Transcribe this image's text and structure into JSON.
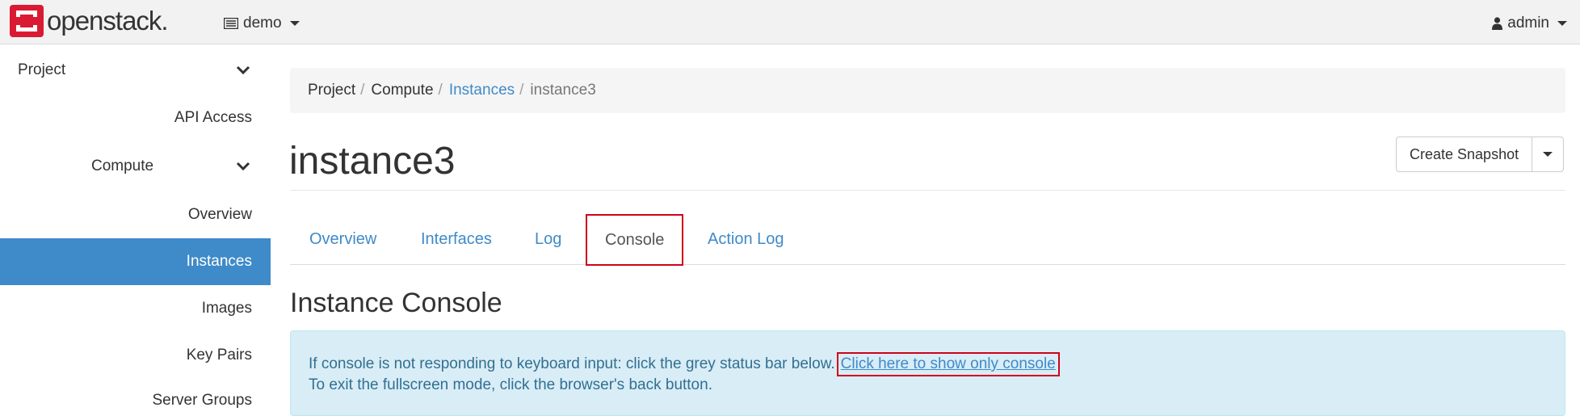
{
  "navbar": {
    "brand": "openstack.",
    "project_selector": "demo",
    "user_menu": "admin",
    "brand_color": "#da1a32"
  },
  "sidebar": {
    "items": [
      {
        "label": "Project",
        "has_chevron": true,
        "active": false
      },
      {
        "label": "API Access",
        "has_chevron": false,
        "active": false
      },
      {
        "label": "Compute",
        "has_chevron": true,
        "active": false
      },
      {
        "label": "Overview",
        "has_chevron": false,
        "active": false
      },
      {
        "label": "Instances",
        "has_chevron": false,
        "active": true
      },
      {
        "label": "Images",
        "has_chevron": false,
        "active": false
      },
      {
        "label": "Key Pairs",
        "has_chevron": false,
        "active": false
      },
      {
        "label": "Server Groups",
        "has_chevron": false,
        "active": false
      }
    ],
    "active_color": "#3f8ac8"
  },
  "breadcrumb": {
    "items": [
      "Project",
      "Compute",
      "Instances",
      "instance3"
    ],
    "separator": "/"
  },
  "page": {
    "title": "instance3",
    "actions": {
      "create_snapshot": "Create Snapshot"
    }
  },
  "tabs": [
    {
      "label": "Overview",
      "active": false
    },
    {
      "label": "Interfaces",
      "active": false
    },
    {
      "label": "Log",
      "active": false
    },
    {
      "label": "Console",
      "active": true
    },
    {
      "label": "Action Log",
      "active": false
    }
  ],
  "console": {
    "heading": "Instance Console",
    "message_line1": "If console is not responding to keyboard input: click the grey status bar below.",
    "show_only_console_link": "Click here to show only console",
    "message_line2": "To exit the fullscreen mode, click the browser's back button."
  },
  "highlight_color": "#d0021b"
}
